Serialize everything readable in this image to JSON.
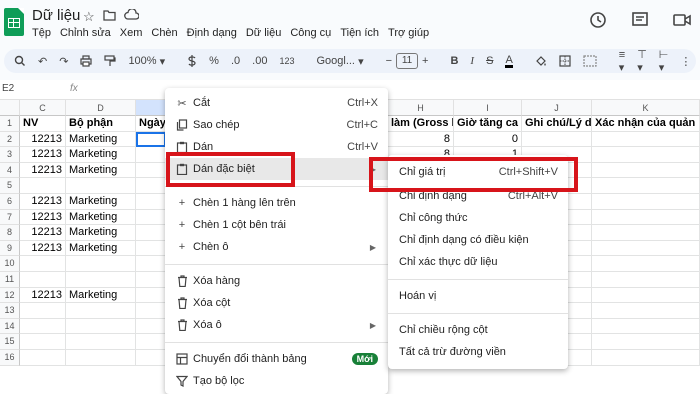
{
  "header": {
    "doc_title": "Dữ liệu",
    "menu": [
      "Tệp",
      "Chỉnh sửa",
      "Xem",
      "Chèn",
      "Định dạng",
      "Dữ liệu",
      "Công cụ",
      "Tiện ích",
      "Trợ giúp"
    ]
  },
  "toolbar": {
    "zoom": "100%",
    "percent": "%",
    "decimals": ".0",
    "decimals_more": ".00",
    "number_format": "123",
    "font": "Googl...",
    "font_size": "11"
  },
  "formula_bar": {
    "name_box": "E2",
    "fx": "fx"
  },
  "grid": {
    "columns": [
      "C",
      "D",
      "H",
      "I",
      "J",
      "K"
    ],
    "row_numbers": [
      "1",
      "2",
      "3",
      "4",
      "5",
      "6",
      "7",
      "8",
      "9",
      "10",
      "11",
      "12",
      "13",
      "14",
      "15",
      "16"
    ],
    "header_row": {
      "C": "NV",
      "D": "Bộ phận",
      "E": "Ngày",
      "H": "làm (Gross h",
      "I": "Giờ tăng ca (C",
      "J": "Ghi chú/Lý do",
      "K": "Xác nhận của quản lý"
    },
    "c_values": [
      "12213",
      "12213",
      "12213",
      "",
      "12213",
      "12213",
      "12213",
      "12213",
      "",
      "",
      "12213"
    ],
    "d_values": [
      "Marketing",
      "Marketing",
      "Marketing",
      "",
      "Marketing",
      "Marketing",
      "Marketing",
      "Marketing",
      "",
      "",
      "Marketing"
    ],
    "h_values": [
      "8",
      "8"
    ],
    "i_values": [
      "0",
      "1"
    ]
  },
  "context_menu": {
    "items": [
      {
        "label": "Cắt",
        "shortcut": "Ctrl+X",
        "icon": "scissors-icon"
      },
      {
        "label": "Sao chép",
        "shortcut": "Ctrl+C",
        "icon": "copy-icon"
      },
      {
        "label": "Dán",
        "shortcut": "Ctrl+V",
        "icon": "paste-icon"
      },
      {
        "label": "Dán đặc biệt",
        "icon": "paste-special-icon"
      },
      {
        "label": "Chèn 1 hàng lên trên",
        "icon": "plus-icon"
      },
      {
        "label": "Chèn 1 cột bên trái",
        "icon": "plus-icon"
      },
      {
        "label": "Chèn ô",
        "icon": "plus-icon"
      },
      {
        "label": "Xóa hàng",
        "icon": "trash-icon"
      },
      {
        "label": "Xóa cột",
        "icon": "trash-icon"
      },
      {
        "label": "Xóa ô",
        "icon": "trash-icon"
      },
      {
        "label": "Chuyển đổi thành bảng",
        "icon": "table-icon",
        "badge": "Mới"
      },
      {
        "label": "Tạo bộ lọc",
        "icon": "filter-icon"
      }
    ]
  },
  "paste_special_menu": {
    "items": [
      {
        "label": "Chỉ giá trị",
        "shortcut": "Ctrl+Shift+V"
      },
      {
        "label": "Chỉ định dạng",
        "shortcut": "Ctrl+Alt+V"
      },
      {
        "label": "Chỉ công thức"
      },
      {
        "label": "Chỉ định dạng có điều kiện"
      },
      {
        "label": "Chỉ xác thực dữ liệu"
      },
      {
        "label": "Hoán vị"
      },
      {
        "label": "Chỉ chiều rộng cột"
      },
      {
        "label": "Tất cả trừ đường viền"
      }
    ]
  },
  "colors": {
    "highlight_box": "#d7141a",
    "sheets_green": "#0f9d58",
    "badge_green": "#188038"
  }
}
